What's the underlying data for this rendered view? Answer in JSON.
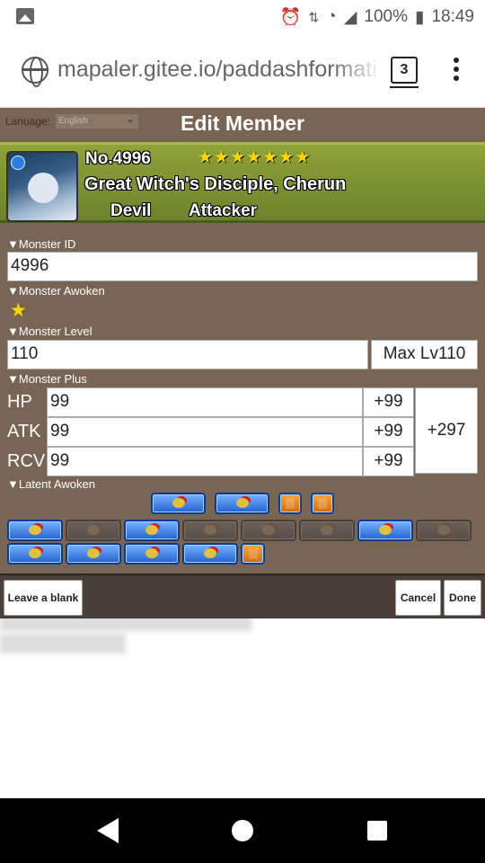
{
  "status_bar": {
    "battery": "100%",
    "time": "18:49"
  },
  "browser": {
    "url": "mapaler.gitee.io/paddashformati",
    "tab_count": "3"
  },
  "dialog": {
    "language_label": "Lanuage:",
    "language_value": "English",
    "title": "Edit Member",
    "monster": {
      "number": "No.4996",
      "stars": "★★★★★★★",
      "name": "Great Witch's Disciple, Cherun",
      "type1": "Devil",
      "type2": "Attacker"
    },
    "sections": {
      "id": "▼Monster ID",
      "awoken": "▼Monster Awoken",
      "level": "▼Monster Level",
      "plus": "▼Monster Plus",
      "latent": "▼Latent Awoken"
    },
    "monster_id": "4996",
    "awoken_star": "★",
    "level": "110",
    "max_level": "Max Lv110",
    "plus": [
      {
        "label": "HP",
        "value": "99",
        "bonus": "+99"
      },
      {
        "label": "ATK",
        "value": "99",
        "bonus": "+99"
      },
      {
        "label": "RCV",
        "value": "99",
        "bonus": "+99"
      }
    ],
    "plus_total": "+297",
    "buttons": {
      "leave_blank": "Leave a blank",
      "cancel": "Cancel",
      "done": "Done"
    }
  }
}
